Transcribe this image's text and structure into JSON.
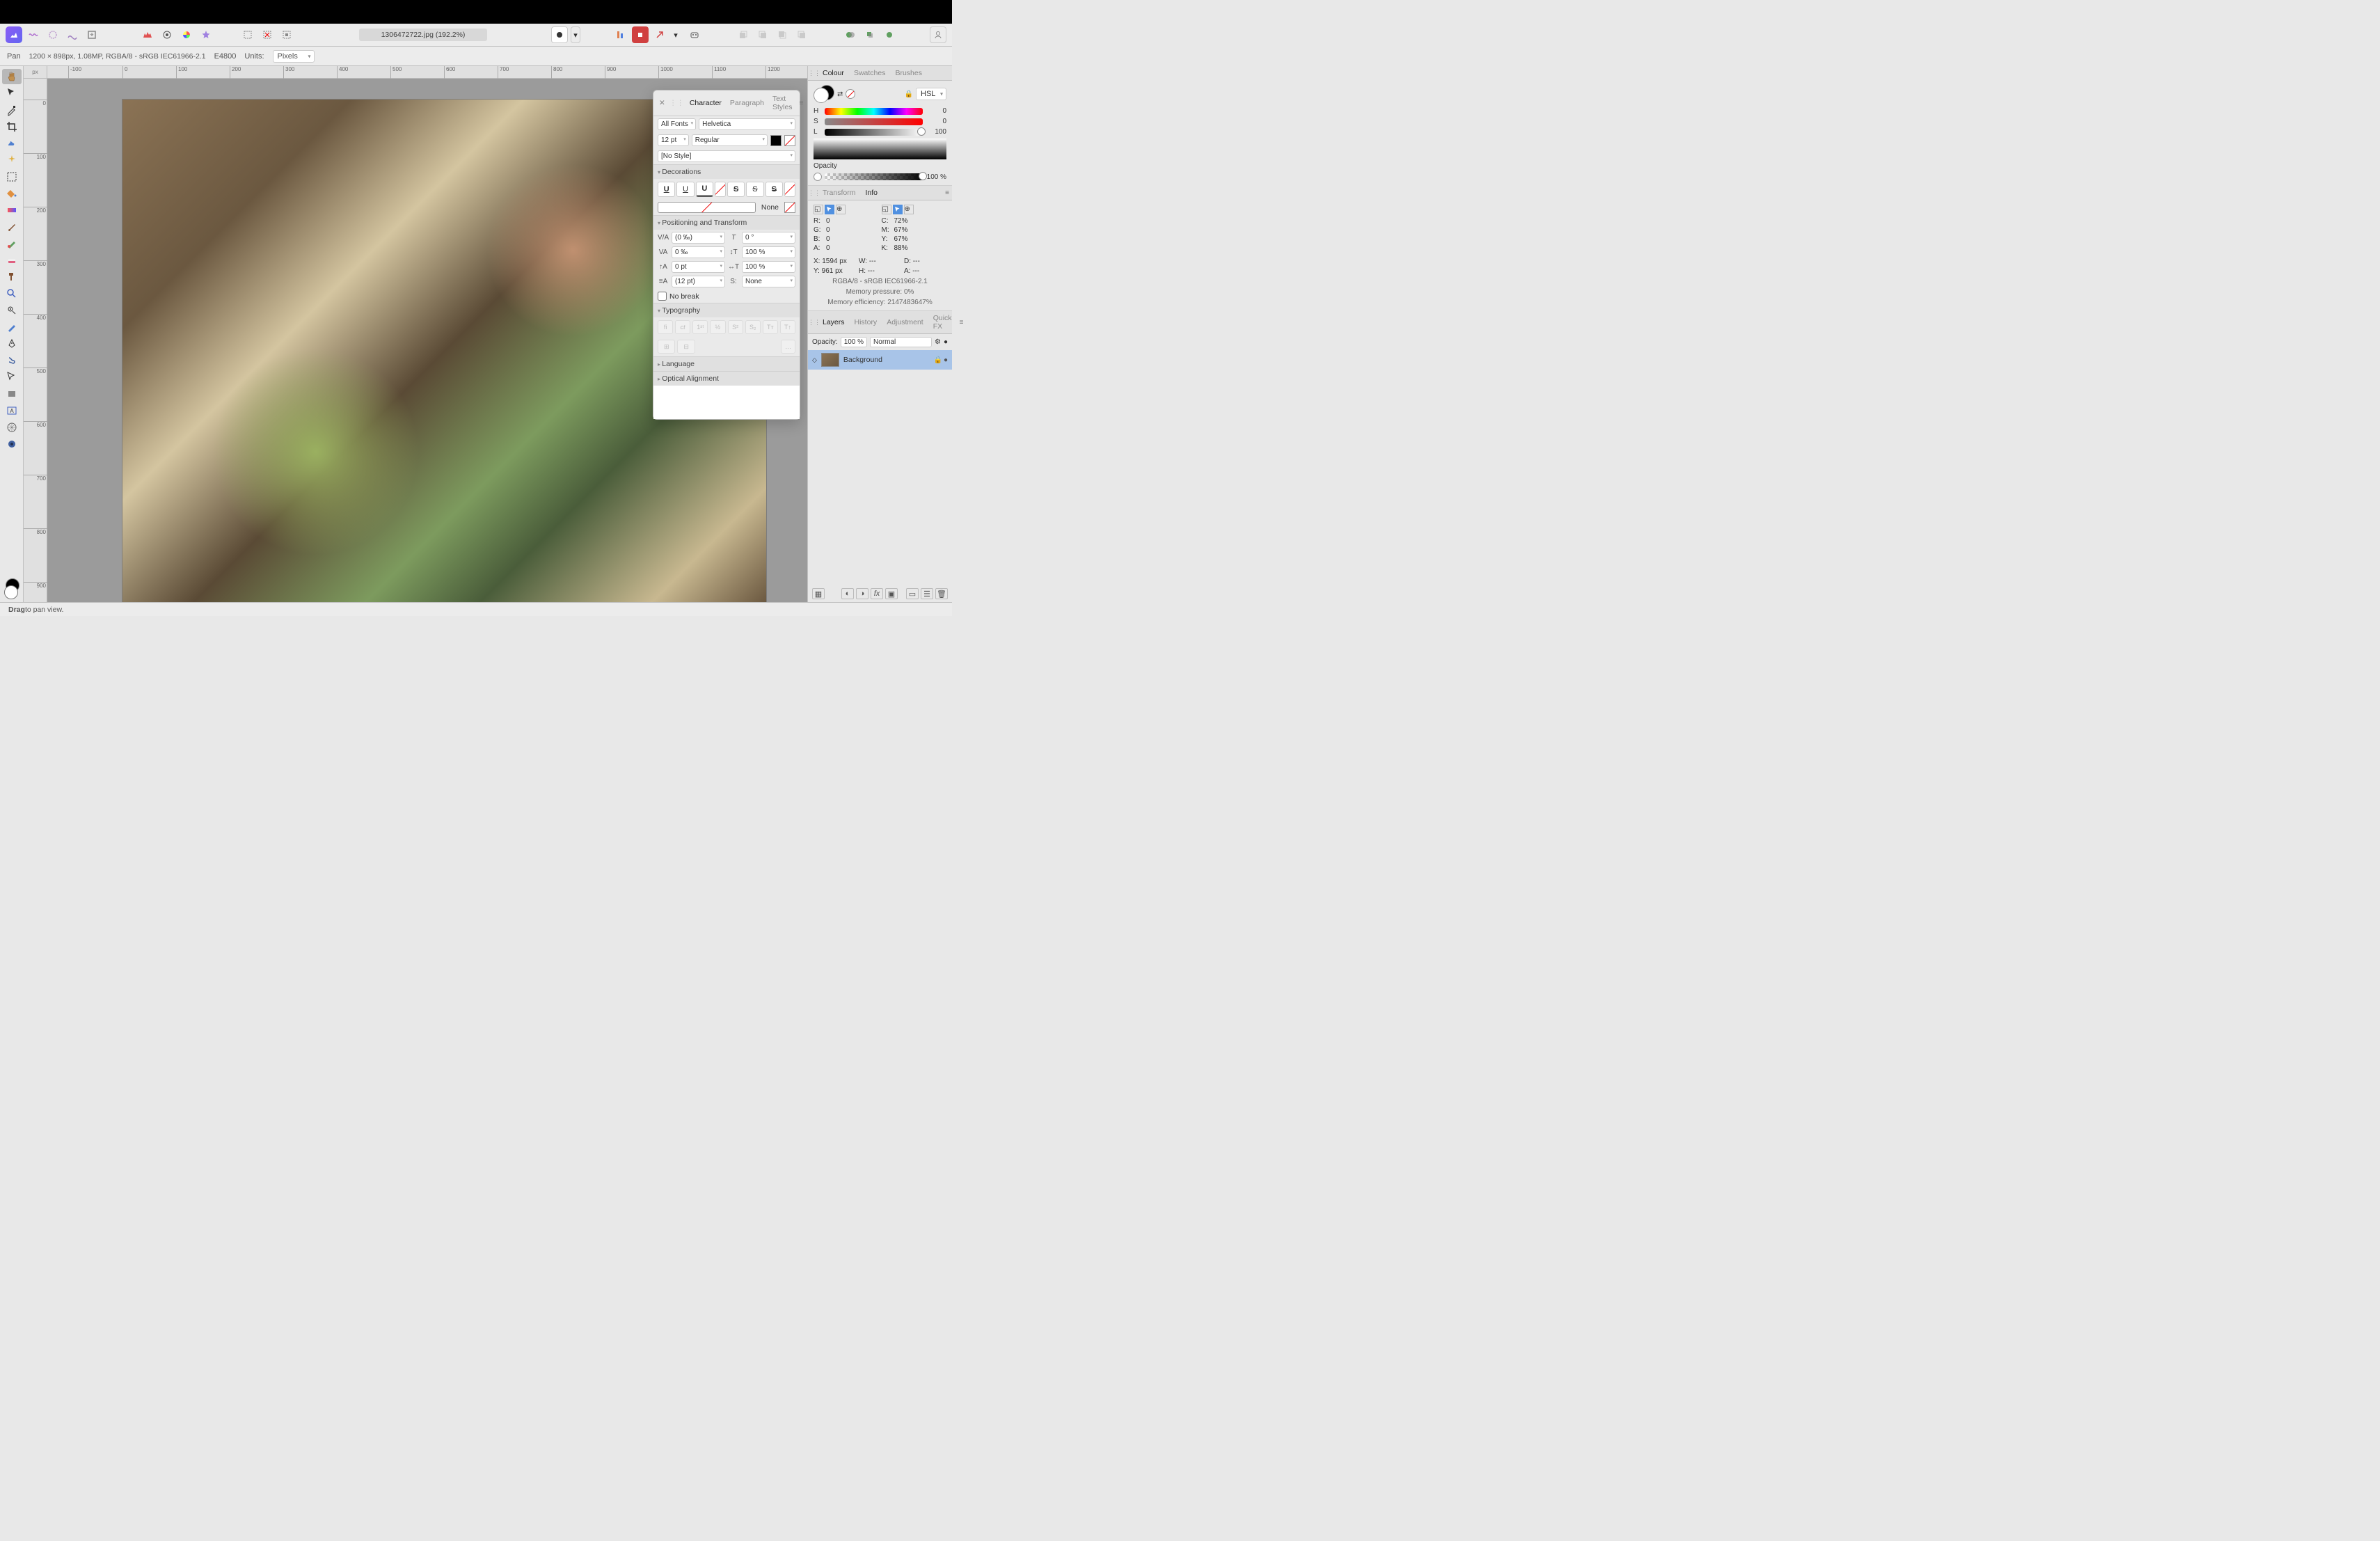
{
  "document": {
    "title": "1306472722.jpg (192.2%)",
    "info": "1200 × 898px, 1.08MP, RGBA/8 - sRGB IEC61966-2.1",
    "hex_code": "E4800"
  },
  "context": {
    "tool": "Pan",
    "units_label": "Units:",
    "units_value": "Pixels"
  },
  "ruler": {
    "corner": "px"
  },
  "char_panel": {
    "tabs": {
      "character": "Character",
      "paragraph": "Paragraph",
      "styles": "Text Styles"
    },
    "font_collection": "All Fonts",
    "font_family": "Helvetica",
    "font_size": "12 pt",
    "font_weight": "Regular",
    "style_name": "[No Style]",
    "decorations_label": "Decorations",
    "none_label": "None",
    "positioning_label": "Positioning and Transform",
    "kerning": "(0 ‰)",
    "tracking": "0 ‰",
    "baseline": "0 pt",
    "leading": "(12 pt)",
    "shear": "0 °",
    "hscale": "100 %",
    "vscale": "100 %",
    "leading_override": "None",
    "no_break": "No break",
    "typography_label": "Typography",
    "language_label": "Language",
    "optical_label": "Optical Alignment"
  },
  "colour_panel": {
    "tabs": {
      "colour": "Colour",
      "swatches": "Swatches",
      "brushes": "Brushes"
    },
    "mode": "HSL",
    "h": "0",
    "s": "0",
    "l": "100",
    "opacity_label": "Opacity",
    "opacity_value": "100 %"
  },
  "info_panel": {
    "tabs": {
      "transform": "Transform",
      "info": "Info"
    },
    "r": "0",
    "g": "0",
    "b": "0",
    "a": "0",
    "c": "72%",
    "m": "67%",
    "y": "67%",
    "k": "88%",
    "x": "X: 1594 px",
    "ypos": "Y: 961 px",
    "w": "W: ---",
    "h": "H: ---",
    "d": "D: ---",
    "ang": "A: ---",
    "profile": "RGBA/8 - sRGB IEC61966-2.1",
    "mem_pressure": "Memory pressure: 0%",
    "mem_eff": "Memory efficiency: 2147483647%"
  },
  "layers_panel": {
    "tabs": {
      "layers": "Layers",
      "history": "History",
      "adjustment": "Adjustment",
      "quickfx": "Quick FX"
    },
    "opacity_label": "Opacity:",
    "opacity_value": "100 %",
    "blend_mode": "Normal",
    "layer_name": "Background"
  },
  "status": {
    "hint_bold": "Drag",
    "hint_rest": " to pan view."
  },
  "color_labels": {
    "H": "H",
    "S": "S",
    "L": "L",
    "R": "R:",
    "G": "G:",
    "B": "B:",
    "A": "A:",
    "C": "C:",
    "M": "M:",
    "Y": "Y:",
    "K": "K:"
  }
}
